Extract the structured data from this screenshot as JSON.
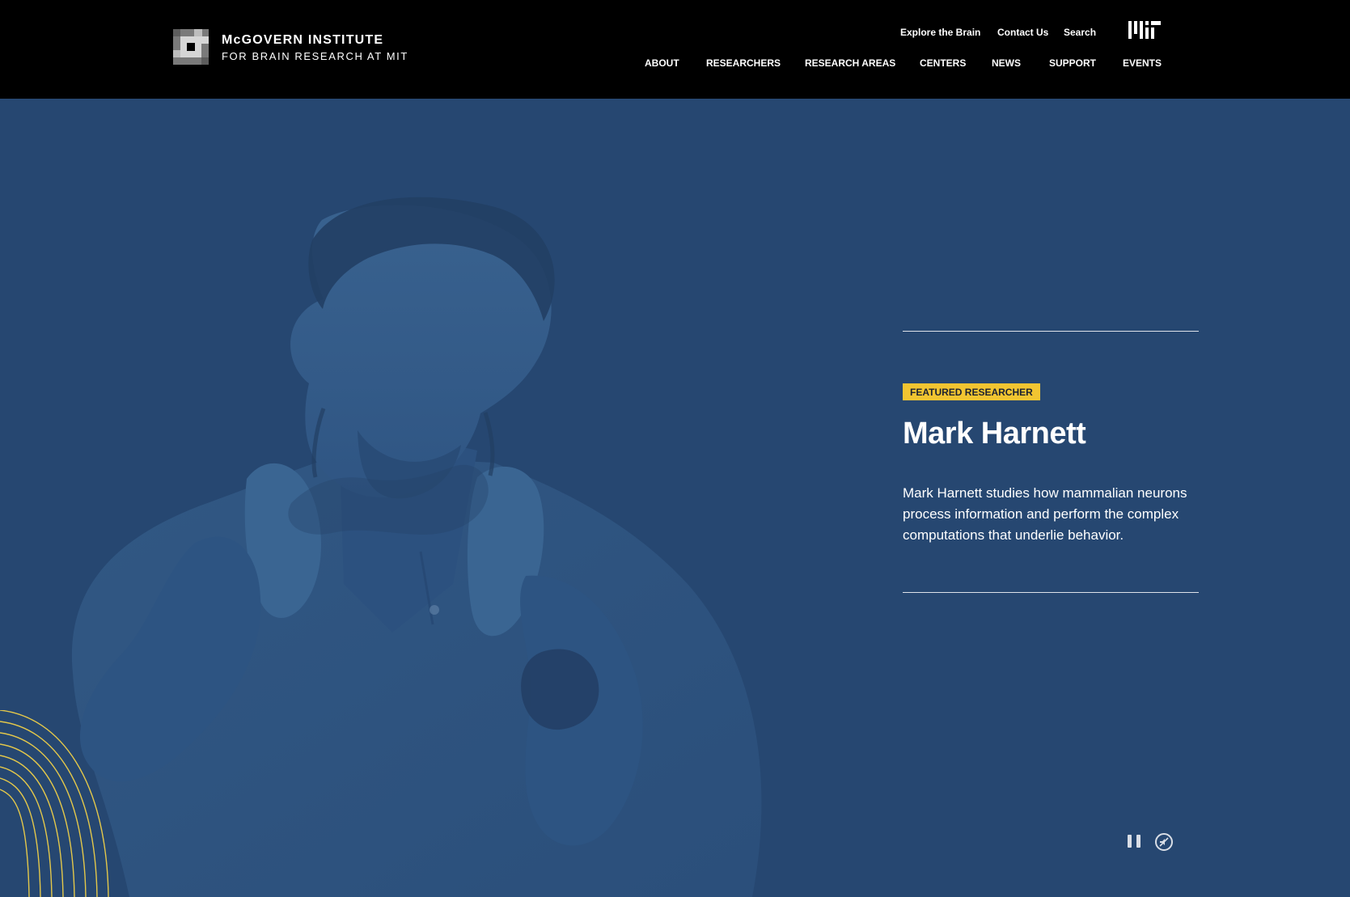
{
  "header": {
    "logo": {
      "title": "McGOVERN INSTITUTE",
      "subtitle": "FOR BRAIN RESEARCH AT MIT"
    },
    "utility_links": [
      "Explore the Brain",
      "Contact Us",
      "Search"
    ],
    "mit_logo": "MIT",
    "nav": [
      "ABOUT",
      "RESEARCHERS",
      "RESEARCH AREAS",
      "CENTERS",
      "NEWS",
      "SUPPORT",
      "EVENTS"
    ]
  },
  "hero": {
    "badge": "FEATURED RESEARCHER",
    "name": "Mark Harnett",
    "description": "Mark Harnett studies how mammalian neurons process information and perform the complex computations that underlie behavior."
  },
  "controls": {
    "pause_icon": "pause-icon",
    "sound_icon": "sound-off-icon"
  },
  "colors": {
    "header_bg": "#000000",
    "hero_bg": "#264771",
    "accent": "#f2c531",
    "text": "#ffffff"
  }
}
